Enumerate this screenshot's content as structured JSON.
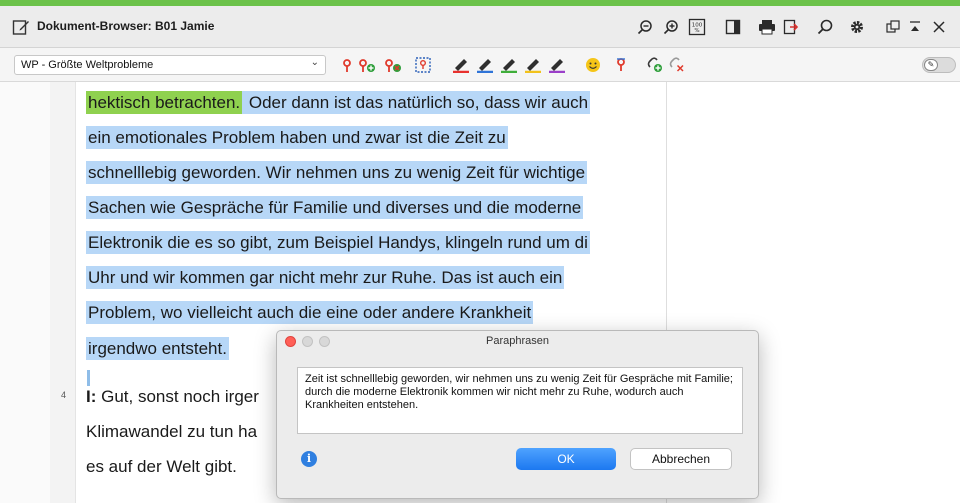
{
  "window": {
    "title": "Dokument-Browser: B01 Jamie"
  },
  "codebar": {
    "selected_code": "WP - Größte Weltprobleme"
  },
  "document": {
    "paragraph_number": "4",
    "lines": [
      {
        "hl_green": "hektisch betrachten.",
        "hl_blue": " Oder dann ist das natürlich so, dass wir auch"
      },
      {
        "hl_blue": "ein emotionales Problem haben und zwar ist die Zeit zu"
      },
      {
        "hl_blue": "schnelllebig geworden. Wir nehmen uns zu wenig Zeit für wichtige"
      },
      {
        "hl_blue": "Sachen wie Gespräche für Familie und diverses und die moderne"
      },
      {
        "hl_blue": "Elektronik die es so gibt, zum Beispiel Handys, klingeln rund um di"
      },
      {
        "hl_blue": "Uhr und wir kommen gar nicht mehr zur Ruhe. Das ist auch ein"
      },
      {
        "hl_blue": "Problem, wo vielleicht auch die eine oder andere Krankheit"
      },
      {
        "hl_blue": "irgendwo entsteht."
      }
    ],
    "speaker": "I:",
    "plain_lines": [
      " Gut, sonst noch irger",
      "Klimawandel zu tun ha",
      "es auf der Welt gibt."
    ]
  },
  "dialog": {
    "title": "Paraphrasen",
    "text": "Zeit ist schnelllebig geworden, wir nehmen uns zu wenig Zeit für Gespräche mit Familie; durch die moderne Elektronik kommen wir nicht mehr zu Ruhe, wodurch auch Krankheiten entstehen.",
    "ok_label": "OK",
    "cancel_label": "Abbrechen"
  },
  "colors": {
    "accent": "#6cc24a",
    "highlight_blue": "#b7d7f7",
    "highlight_green": "#8fd14f",
    "ok_button": "#1c78f0"
  },
  "icons": {
    "titlebar": [
      "zoom-out-icon",
      "zoom-in-icon",
      "zoom-100-icon",
      "panel-toggle-icon",
      "print-icon",
      "export-icon",
      "search-icon",
      "settings-gear-icon",
      "undock-icon",
      "collapse-icon",
      "close-icon"
    ],
    "codebar": [
      "code-icon",
      "code-add-icon",
      "code-remove-icon",
      "select-area-icon",
      "pen-red-icon",
      "pen-blue-icon",
      "pen-green-icon",
      "pen-yellow-icon",
      "pen-purple-icon",
      "emoticon-icon",
      "code-marker-icon",
      "link-add-icon",
      "link-remove-icon"
    ]
  }
}
